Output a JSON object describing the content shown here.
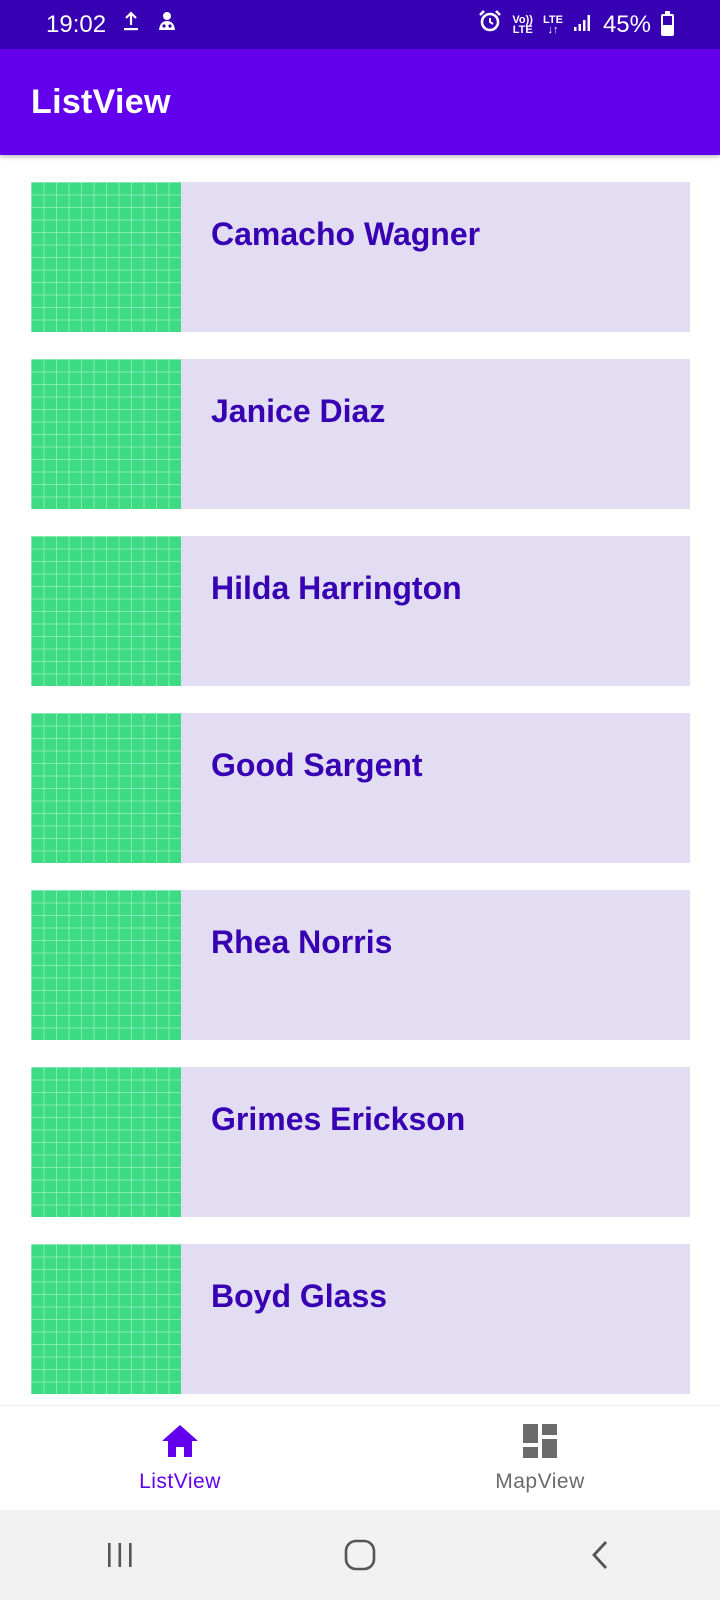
{
  "status_bar": {
    "time": "19:02",
    "volte_label_top": "Vo))",
    "volte_label_bottom": "LTE",
    "lte_label": "LTE",
    "battery_percent": "45%",
    "battery_level": 0.45
  },
  "app_bar": {
    "title": "ListView"
  },
  "list": {
    "items": [
      {
        "name": "Camacho Wagner"
      },
      {
        "name": "Janice Diaz"
      },
      {
        "name": "Hilda Harrington"
      },
      {
        "name": "Good Sargent"
      },
      {
        "name": "Rhea Norris"
      },
      {
        "name": "Grimes Erickson"
      },
      {
        "name": "Boyd Glass"
      }
    ]
  },
  "bottom_nav": {
    "items": [
      {
        "label": "ListView",
        "icon": "home-icon",
        "active": true
      },
      {
        "label": "MapView",
        "icon": "dashboard-icon",
        "active": false
      }
    ]
  },
  "colors": {
    "status_bar": "#3700b3",
    "app_bar": "#6200ee",
    "card_background": "#e3ddf3",
    "thumbnail": "#3ddc84",
    "name_text": "#3700b3"
  }
}
